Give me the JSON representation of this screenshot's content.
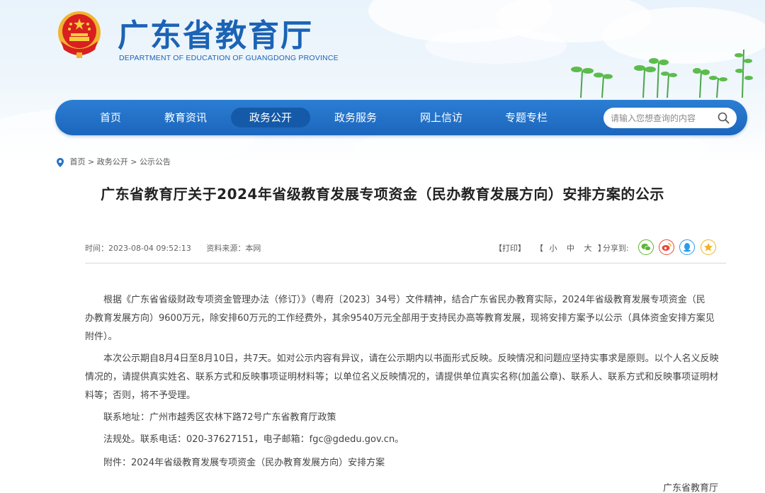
{
  "header": {
    "title": "广东省教育厅",
    "subtitle": "DEPARTMENT OF EDUCATION OF GUANGDONG PROVINCE"
  },
  "nav": {
    "items": [
      {
        "label": "首页"
      },
      {
        "label": "教育资讯"
      },
      {
        "label": "政务公开",
        "active": true
      },
      {
        "label": "政务服务"
      },
      {
        "label": "网上信访"
      },
      {
        "label": "专题专栏"
      }
    ],
    "search_placeholder": "请输入您想查询的内容"
  },
  "breadcrumb": {
    "items": [
      "首页",
      "政务公开",
      "公示公告"
    ],
    "separator": ">"
  },
  "article": {
    "title": "广东省教育厅关于2024年省级教育发展专项资金（民办教育发展方向）安排方案的公示",
    "time": "时间：2023-08-04 09:52:13",
    "source": "资料来源：本网",
    "print": "【打印】",
    "size_open": "【",
    "size_small": "小",
    "size_medium": "中",
    "size_large": "大",
    "size_close": "】",
    "share_label": "分享到:",
    "share_icons": [
      {
        "name": "wechat-icon",
        "color": "#5cb531"
      },
      {
        "name": "weibo-icon",
        "color": "#e8483b"
      },
      {
        "name": "qq-icon",
        "color": "#2b9ce8"
      },
      {
        "name": "qzone-icon",
        "color": "#f0b320"
      }
    ],
    "para1_lines": [
      "根据《广东省省级财政专项资金管理办法（修订）》（粤府〔2023〕34号）文件精神，结合广东省民办教育实际，2024年省级教育发展专项资金（民",
      "办教育发展方向）9600万元，除安排60万元的工作经费外，其余9540万元全部用于支持民办高等教育发展，现将安排方案予以公示（具体资金安排方案见",
      "附件）。"
    ],
    "para2_lines": [
      "本次公示期自8月4日至8月10日，共7天。如对公示内容有异议，请在公示期内以书面形式反映。反映情况和问题应坚持实事求是原则。以个人名义反映",
      "情况的，请提供真实姓名、联系方式和反映事项证明材料等；以单位名义反映情况的，请提供单位真实名称(加盖公章)、联系人、联系方式和反映事项证明材",
      "料等；否则，将不予受理。"
    ],
    "address": "联系地址：广州市越秀区农林下路72号广东省教育厅政策",
    "contact": "法规处。联系电话：020-37627151，电子邮箱：fgc@gdedu.gov.cn。",
    "attachment": "附件：2024年省级教育发展专项资金（民办教育发展方向）安排方案",
    "signature": "广东省教育厅"
  }
}
